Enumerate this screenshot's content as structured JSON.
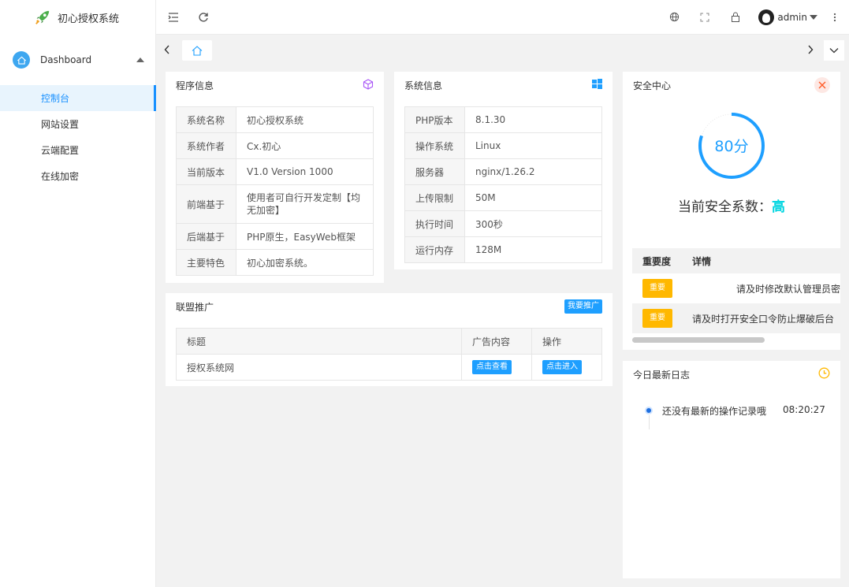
{
  "app": {
    "name": "初心授权系统"
  },
  "sidebar": {
    "group_label": "Dashboard",
    "items": [
      {
        "label": "控制台",
        "active": true
      },
      {
        "label": "网站设置"
      },
      {
        "label": "云端配置"
      },
      {
        "label": "在线加密"
      }
    ]
  },
  "header": {
    "username": "admin"
  },
  "program_info": {
    "title": "程序信息",
    "rows": [
      {
        "key": "系统名称",
        "value": "初心授权系统"
      },
      {
        "key": "系统作者",
        "value": "Cx.初心"
      },
      {
        "key": "当前版本",
        "value": "V1.0 Version 1000"
      },
      {
        "key": "前端基于",
        "value": "使用者可自行开发定制【均无加密】"
      },
      {
        "key": "后端基于",
        "value": "PHP原生，EasyWeb框架"
      },
      {
        "key": "主要特色",
        "value": "初心加密系统。"
      }
    ]
  },
  "system_info": {
    "title": "系统信息",
    "rows": [
      {
        "key": "PHP版本",
        "value": "8.1.30"
      },
      {
        "key": "操作系统",
        "value": "Linux"
      },
      {
        "key": "服务器",
        "value": "nginx/1.26.2"
      },
      {
        "key": "上传限制",
        "value": "50M"
      },
      {
        "key": "执行时间",
        "value": "300秒"
      },
      {
        "key": "运行内存",
        "value": "128M"
      }
    ]
  },
  "security": {
    "title": "安全中心",
    "score_text": "80分",
    "score_fraction": 0.8,
    "level_label": "当前安全系数：",
    "level_value": "高",
    "columns": [
      "重要度",
      "详情"
    ],
    "rows": [
      {
        "badge": "重要",
        "detail": "请及时修改默认管理员密"
      },
      {
        "badge": "重要",
        "detail": "请及时打开安全口令防止爆破后台"
      }
    ]
  },
  "promo": {
    "title": "联盟推广",
    "header_button": "我要推广",
    "columns": [
      "标题",
      "广告内容",
      "操作"
    ],
    "rows": [
      {
        "title": "授权系统网",
        "view_button": "点击查看",
        "enter_button": "点击进入"
      }
    ]
  },
  "logs": {
    "title": "今日最新日志",
    "entries": [
      {
        "text": "还没有最新的操作记录哦",
        "time": "08:20:27"
      }
    ]
  },
  "colors": {
    "accent": "#1e9fff",
    "warning": "#ffb800",
    "danger": "#ff5722"
  }
}
